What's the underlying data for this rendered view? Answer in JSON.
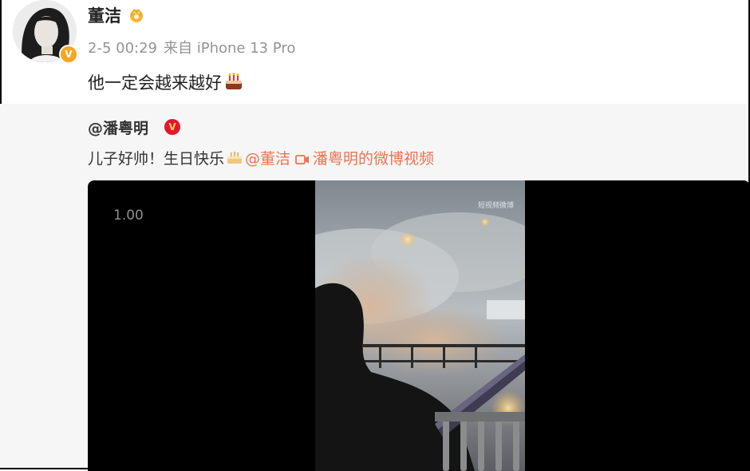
{
  "post": {
    "author": "董洁",
    "date": "2-5 00:29",
    "source": "来自 iPhone 13 Pro",
    "text": "他一定会越来越好",
    "text_emoji": "cake-emoji-icon"
  },
  "repost": {
    "original_author": "@潘粤明",
    "text": "儿子好帅！生日快乐",
    "mention": "@董洁",
    "video_link": "潘粤明的微博视频"
  },
  "video": {
    "speed": "1.00",
    "watermark": "短视频微博"
  },
  "colors": {
    "link": "#eb7350",
    "meta": "#939393",
    "repost_bg": "#f6f6f6",
    "badge_gold": "#f5a623",
    "badge_red": "#e6162d"
  }
}
